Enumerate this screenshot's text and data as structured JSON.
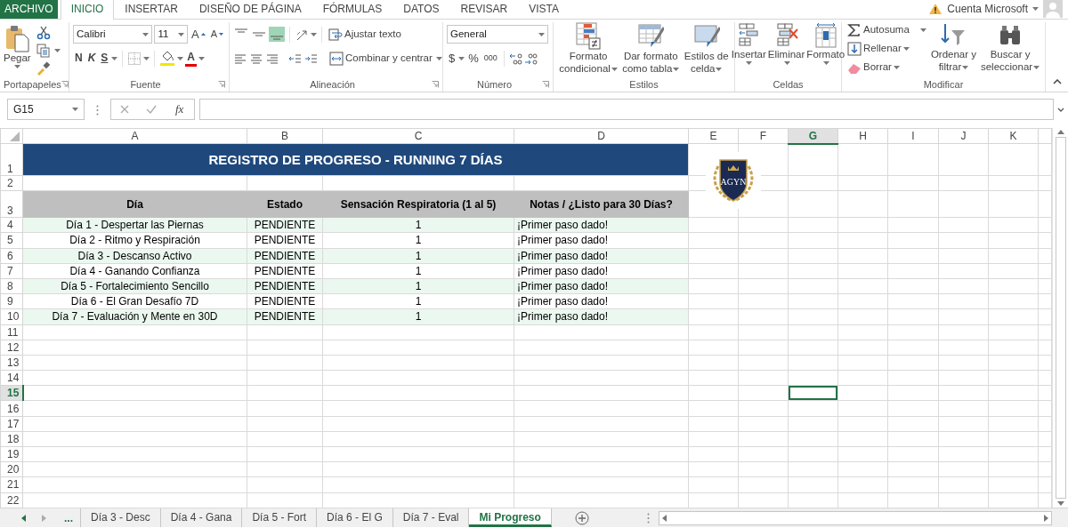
{
  "menu_tabs": [
    {
      "label": "ARCHIVO",
      "kind": "file",
      "selected": false
    },
    {
      "label": "INICIO",
      "kind": "tab",
      "selected": true
    },
    {
      "label": "INSERTAR",
      "kind": "tab",
      "selected": false
    },
    {
      "label": "DISEÑO DE PÁGINA",
      "kind": "tab",
      "selected": false
    },
    {
      "label": "FÓRMULAS",
      "kind": "tab",
      "selected": false
    },
    {
      "label": "DATOS",
      "kind": "tab",
      "selected": false
    },
    {
      "label": "REVISAR",
      "kind": "tab",
      "selected": false
    },
    {
      "label": "VISTA",
      "kind": "tab",
      "selected": false
    }
  ],
  "account": {
    "label": "Cuenta Microsoft"
  },
  "clipboard": {
    "paste": "Pegar",
    "group_label": "Portapapeles"
  },
  "font": {
    "name": "Calibri",
    "size": "11",
    "grow": "A",
    "shrink": "A",
    "bold": "N",
    "italic": "K",
    "underline": "S",
    "font_color": "A",
    "group_label": "Fuente"
  },
  "alignment": {
    "vertical": [
      {
        "selected": false
      },
      {
        "selected": false
      },
      {
        "selected": true
      }
    ],
    "wrap_text": "Ajustar texto",
    "merge": "Combinar y centrar",
    "group_label": "Alineación"
  },
  "number": {
    "format": "General",
    "currency": "$",
    "percent": "%",
    "thousands": "000",
    "group_label": "Número"
  },
  "styles": {
    "buttons": [
      "Formato condicional",
      "Dar formato como tabla",
      "Estilos de celda"
    ],
    "group_label": "Estilos"
  },
  "cells": {
    "buttons": [
      "Insertar",
      "Eliminar",
      "Formato"
    ],
    "group_label": "Celdas"
  },
  "editing": {
    "autosum": "Autosuma",
    "fill": "Rellenar",
    "clear": "Borrar",
    "sort": "Ordenar y filtrar",
    "find": "Buscar y seleccionar",
    "group_label": "Modificar"
  },
  "formula_bar": {
    "name_box": "G15",
    "fx": "fx"
  },
  "sheet": {
    "columns": [
      {
        "label": "A",
        "selected": false
      },
      {
        "label": "B",
        "selected": false
      },
      {
        "label": "C",
        "selected": false
      },
      {
        "label": "D",
        "selected": false
      },
      {
        "label": "E",
        "selected": false
      },
      {
        "label": "F",
        "selected": false
      },
      {
        "label": "G",
        "selected": true
      },
      {
        "label": "H",
        "selected": false
      },
      {
        "label": "I",
        "selected": false
      },
      {
        "label": "J",
        "selected": false
      },
      {
        "label": "K",
        "selected": false
      }
    ],
    "row_numbers": [
      {
        "label": "1",
        "selected": false
      },
      {
        "label": "2",
        "selected": false
      },
      {
        "label": "3",
        "selected": false
      },
      {
        "label": "4",
        "selected": false
      },
      {
        "label": "5",
        "selected": false
      },
      {
        "label": "6",
        "selected": false
      },
      {
        "label": "7",
        "selected": false
      },
      {
        "label": "8",
        "selected": false
      },
      {
        "label": "9",
        "selected": false
      },
      {
        "label": "10",
        "selected": false
      },
      {
        "label": "11",
        "selected": false
      },
      {
        "label": "12",
        "selected": false
      },
      {
        "label": "13",
        "selected": false
      },
      {
        "label": "14",
        "selected": false
      },
      {
        "label": "15",
        "selected": true
      },
      {
        "label": "16",
        "selected": false
      },
      {
        "label": "17",
        "selected": false
      },
      {
        "label": "18",
        "selected": false
      },
      {
        "label": "19",
        "selected": false
      },
      {
        "label": "20",
        "selected": false
      },
      {
        "label": "21",
        "selected": false
      },
      {
        "label": "22",
        "selected": false
      }
    ],
    "title": "REGISTRO DE PROGRESO - RUNNING 7 DÍAS",
    "headers": [
      "Día",
      "Estado",
      "Sensación Respiratoria (1 al 5)",
      "Notas / ¿Listo para 30 Días?"
    ],
    "rows": [
      [
        "Día 1 - Despertar las Piernas",
        "PENDIENTE",
        "1",
        "¡Primer paso dado!"
      ],
      [
        "Día 2 - Ritmo y Respiración",
        "PENDIENTE",
        "1",
        "¡Primer paso dado!"
      ],
      [
        "Día 3 - Descanso Activo",
        "PENDIENTE",
        "1",
        "¡Primer paso dado!"
      ],
      [
        "Día 4 - Ganando Confianza",
        "PENDIENTE",
        "1",
        "¡Primer paso dado!"
      ],
      [
        "Día 5 - Fortalecimiento Sencillo",
        "PENDIENTE",
        "1",
        "¡Primer paso dado!"
      ],
      [
        "Día 6 - El Gran Desafío 7D",
        "PENDIENTE",
        "1",
        "¡Primer paso dado!"
      ],
      [
        "Día 7 - Evaluación y Mente en 30D",
        "PENDIENTE",
        "1",
        "¡Primer paso dado!"
      ]
    ]
  },
  "logo": {
    "text": "AGYN"
  },
  "sheet_tabs": {
    "more": "...",
    "tabs": [
      {
        "label": "Día 3 - Desc",
        "selected": false
      },
      {
        "label": "Día 4 - Gana",
        "selected": false
      },
      {
        "label": "Día 5 - Fort",
        "selected": false
      },
      {
        "label": "Día 6 - El G",
        "selected": false
      },
      {
        "label": "Día 7 - Eval",
        "selected": false
      },
      {
        "label": "Mi Progreso",
        "selected": true
      }
    ]
  }
}
